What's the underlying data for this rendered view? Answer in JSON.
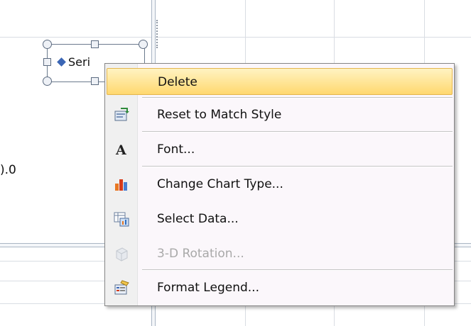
{
  "worksheet": {
    "axis_value_partial": ").0"
  },
  "legend": {
    "text_partial": "Seri"
  },
  "context_menu": {
    "items": [
      {
        "label": "Delete",
        "icon": "none",
        "highlighted": true,
        "disabled": false
      },
      {
        "label": "Reset to Match Style",
        "icon": "reset-style-icon",
        "highlighted": false,
        "disabled": false
      },
      {
        "label": "Font...",
        "icon": "font-icon",
        "highlighted": false,
        "disabled": false
      },
      {
        "label": "Change Chart Type...",
        "icon": "chart-type-icon",
        "highlighted": false,
        "disabled": false
      },
      {
        "label": "Select Data...",
        "icon": "select-data-icon",
        "highlighted": false,
        "disabled": false
      },
      {
        "label": "3-D Rotation...",
        "icon": "rotation-3d-icon",
        "highlighted": false,
        "disabled": true
      },
      {
        "label": "Format Legend...",
        "icon": "format-legend-icon",
        "highlighted": false,
        "disabled": false
      }
    ]
  },
  "colors": {
    "highlight_top": "#fff3c2",
    "highlight_bottom": "#ffd86f",
    "menu_background": "#fbf7fb",
    "disabled_text": "#a9a9a9"
  }
}
